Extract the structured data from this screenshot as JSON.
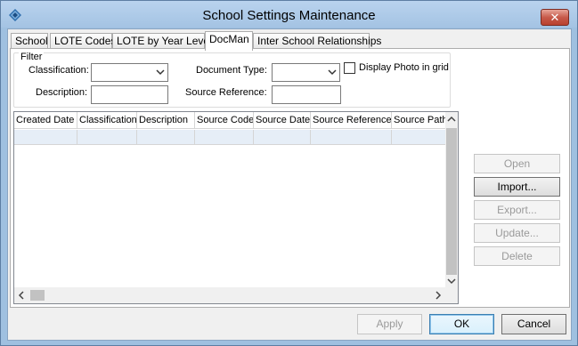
{
  "window": {
    "title": "School Settings Maintenance",
    "close_label": "✕"
  },
  "tabs": [
    {
      "label": "School",
      "active": false
    },
    {
      "label": "LOTE Codes",
      "active": false
    },
    {
      "label": "LOTE by Year Level",
      "active": false
    },
    {
      "label": "DocMan",
      "active": true
    },
    {
      "label": "Inter School Relationships",
      "active": false
    }
  ],
  "filter": {
    "legend": "Filter",
    "classification_label": "Classification:",
    "classification_value": "",
    "document_type_label": "Document Type:",
    "document_type_value": "",
    "display_photo_label": "Display Photo in grid",
    "display_photo_checked": false,
    "description_label": "Description:",
    "description_value": "",
    "source_reference_label": "Source Reference:",
    "source_reference_value": ""
  },
  "grid": {
    "columns": [
      "Created Date",
      "Classification",
      "Description",
      "Source Code",
      "Source Date",
      "Source Reference",
      "Source Path"
    ],
    "rows": [
      [
        "",
        "",
        "",
        "",
        "",
        "",
        ""
      ]
    ]
  },
  "side_buttons": {
    "open": "Open",
    "import": "Import...",
    "export": "Export...",
    "update": "Update...",
    "delete": "Delete"
  },
  "footer": {
    "apply": "Apply",
    "ok": "OK",
    "cancel": "Cancel"
  }
}
